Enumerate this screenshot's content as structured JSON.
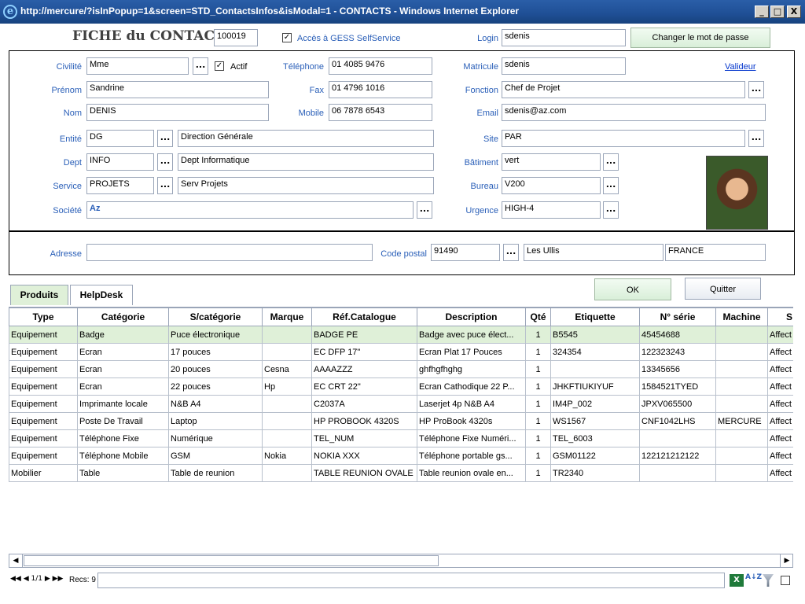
{
  "window": {
    "title": "http://mercure/?isInPopup=1&screen=STD_ContactsInfos&isModal=1 - CONTACTS - Windows Internet Explorer",
    "min": "_",
    "max": "□",
    "close": "X"
  },
  "header": {
    "title": "FICHE du CONTACT",
    "id": "100019",
    "gess_label": "Accès à GESS SelfService",
    "gess_checked": "✓",
    "login_label": "Login",
    "login_value": "sdenis",
    "change_pw": "Changer le mot de passe"
  },
  "contact": {
    "civilite_label": "Civilité",
    "civilite": "Mme",
    "actif_label": "Actif",
    "actif_checked": "✓",
    "telephone_label": "Téléphone",
    "telephone": "01 4085 9476",
    "matricule_label": "Matricule",
    "matricule": "sdenis",
    "valideur": "Valideur",
    "prenom_label": "Prénom",
    "prenom": "Sandrine",
    "fax_label": "Fax",
    "fax": "01 4796 1016",
    "fonction_label": "Fonction",
    "fonction": "Chef de Projet",
    "nom_label": "Nom",
    "nom": "DENIS",
    "mobile_label": "Mobile",
    "mobile": "06 7878 6543",
    "email_label": "Email",
    "email": "sdenis@az.com",
    "entite_label": "Entité",
    "entite_code": "DG",
    "entite_name": "Direction Générale",
    "site_label": "Site",
    "site": "PAR",
    "dept_label": "Dept",
    "dept_code": "INFO",
    "dept_name": "Dept Informatique",
    "batiment_label": "Bâtiment",
    "batiment": "vert",
    "service_label": "Service",
    "service_code": "PROJETS",
    "service_name": "Serv Projets",
    "bureau_label": "Bureau",
    "bureau": "V200",
    "societe_label": "Société",
    "societe": "Az",
    "urgence_label": "Urgence",
    "urgence": "HIGH-4",
    "dots": "..."
  },
  "address": {
    "adresse_label": "Adresse",
    "adresse": "",
    "cp_label": "Code postal",
    "cp": "91490",
    "ville": "Les Ullis",
    "pays": "FRANCE"
  },
  "tabs": {
    "produits": "Produits",
    "helpdesk": "HelpDesk"
  },
  "actions": {
    "ok": "OK",
    "quitter": "Quitter"
  },
  "grid": {
    "columns": [
      "Type",
      "Catégorie",
      "S/catégorie",
      "Marque",
      "Réf.Catalogue",
      "Description",
      "Qté",
      "Etiquette",
      "N° série",
      "Machine",
      "S"
    ],
    "rows": [
      [
        "Equipement",
        "Badge",
        "Puce électronique",
        "",
        "BADGE PE",
        "Badge avec puce élect...",
        "1",
        "B5545",
        "45454688",
        "",
        "Affect"
      ],
      [
        "Equipement",
        "Ecran",
        "17 pouces",
        "",
        "EC DFP 17\"",
        "Ecran Plat 17 Pouces",
        "1",
        "324354",
        "122323243",
        "",
        "Affect"
      ],
      [
        "Equipement",
        "Ecran",
        "20 pouces",
        "Cesna",
        "AAAAZZZ",
        "ghfhgfhghg",
        "1",
        "",
        "13345656",
        "",
        "Affect"
      ],
      [
        "Equipement",
        "Ecran",
        "22 pouces",
        "Hp",
        "EC CRT 22\"",
        "Ecran Cathodique 22 P...",
        "1",
        "JHKFTIUKIYUF",
        "1584521TYED",
        "",
        "Affect"
      ],
      [
        "Equipement",
        "Imprimante locale",
        "N&B A4",
        "",
        "C2037A",
        "Laserjet 4p N&B A4",
        "1",
        "IM4P_002",
        "JPXV065500",
        "",
        "Affect"
      ],
      [
        "Equipement",
        "Poste De Travail",
        "Laptop",
        "",
        "HP PROBOOK 4320S",
        "HP ProBook 4320s",
        "1",
        "WS1567",
        "CNF1042LHS",
        "MERCURE",
        "Affect"
      ],
      [
        "Equipement",
        "Téléphone Fixe",
        "Numérique",
        "",
        "TEL_NUM",
        "Téléphone Fixe Numéri...",
        "1",
        "TEL_6003",
        "",
        "",
        "Affect"
      ],
      [
        "Equipement",
        "Téléphone Mobile",
        "GSM",
        "Nokia",
        "NOKIA XXX",
        "Téléphone portable gs...",
        "1",
        "GSM01122",
        "122121212122",
        "",
        "Affect"
      ],
      [
        "Mobilier",
        "Table",
        "Table de reunion",
        "",
        "TABLE REUNION OVALE",
        "Table reunion ovale en...",
        "1",
        "TR2340",
        "",
        "",
        "Affect"
      ]
    ]
  },
  "pager": {
    "nav": "◀◀ ◀ 1/1 ▶ ▶▶",
    "recs": "Recs: 9",
    "sort_icon": "A↓Z"
  },
  "scroll": {
    "left": "◀",
    "right": "▶"
  },
  "colors": {
    "label_blue": "#2a5fb8",
    "title_bar": "#1f4f95",
    "selected_row": "#dff0d8"
  }
}
